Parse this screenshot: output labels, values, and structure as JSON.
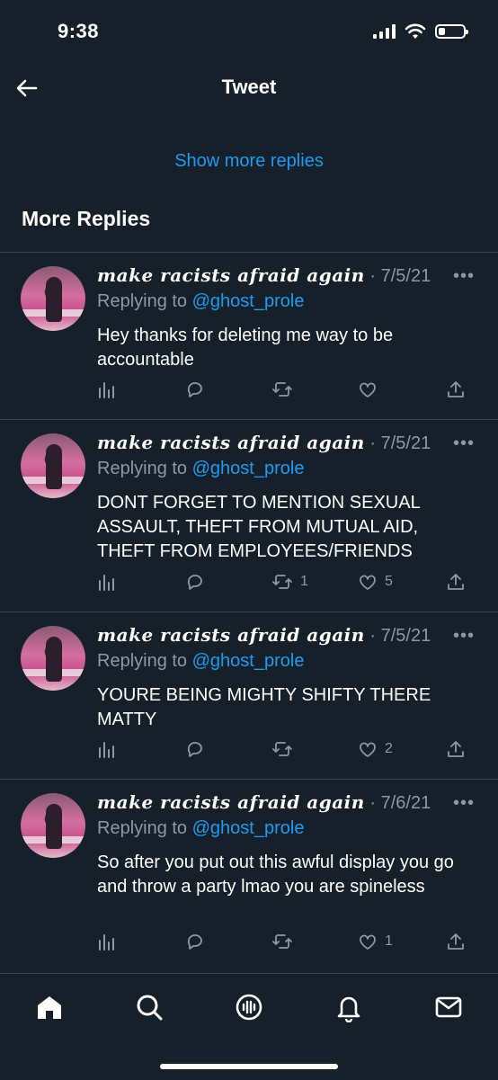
{
  "status": {
    "time": "9:38",
    "icons": [
      "signal-icon",
      "wifi-icon",
      "battery-icon"
    ],
    "battery_level": 0.25
  },
  "header": {
    "back_icon": "arrow-left-icon",
    "title": "Tweet"
  },
  "show_more": "Show more replies",
  "section_title": "More Replies",
  "colors": {
    "background": "#15202b",
    "link": "#1d9bf0",
    "muted": "#8b98a5",
    "divider": "#38444d"
  },
  "tweets": [
    {
      "name": "make racists afraid again",
      "separator": " · ",
      "date": "7/5/21",
      "more": "•••",
      "replying_prefix": "Replying to ",
      "replying_handle": "@ghost_prole",
      "text": "Hey thanks for deleting me way to be accountable",
      "retweets": "",
      "likes": ""
    },
    {
      "name": "make racists afraid again",
      "separator": " · ",
      "date": "7/5/21",
      "more": "•••",
      "replying_prefix": "Replying to ",
      "replying_handle": "@ghost_prole",
      "text": "DONT FORGET TO MENTION SEXUAL ASSAULT, THEFT FROM MUTUAL AID, THEFT FROM EMPLOYEES/FRIENDS",
      "retweets": "1",
      "likes": "5"
    },
    {
      "name": "make racists afraid again",
      "separator": " · ",
      "date": "7/5/21",
      "more": "•••",
      "replying_prefix": "Replying to ",
      "replying_handle": "@ghost_prole",
      "text": "YOURE BEING MIGHTY SHIFTY THERE MATTY",
      "retweets": "",
      "likes": "2"
    },
    {
      "name": "make racists afraid again",
      "separator": " · ",
      "date": "7/6/21",
      "more": "•••",
      "replying_prefix": "Replying to ",
      "replying_handle": "@ghost_prole",
      "text": "So after you put out this awful display you go and throw a party lmao you are spineless",
      "retweets": "",
      "likes": "1"
    }
  ],
  "tabbar": {
    "items": [
      "home-icon",
      "search-icon",
      "spaces-icon",
      "notifications-icon",
      "messages-icon"
    ]
  }
}
